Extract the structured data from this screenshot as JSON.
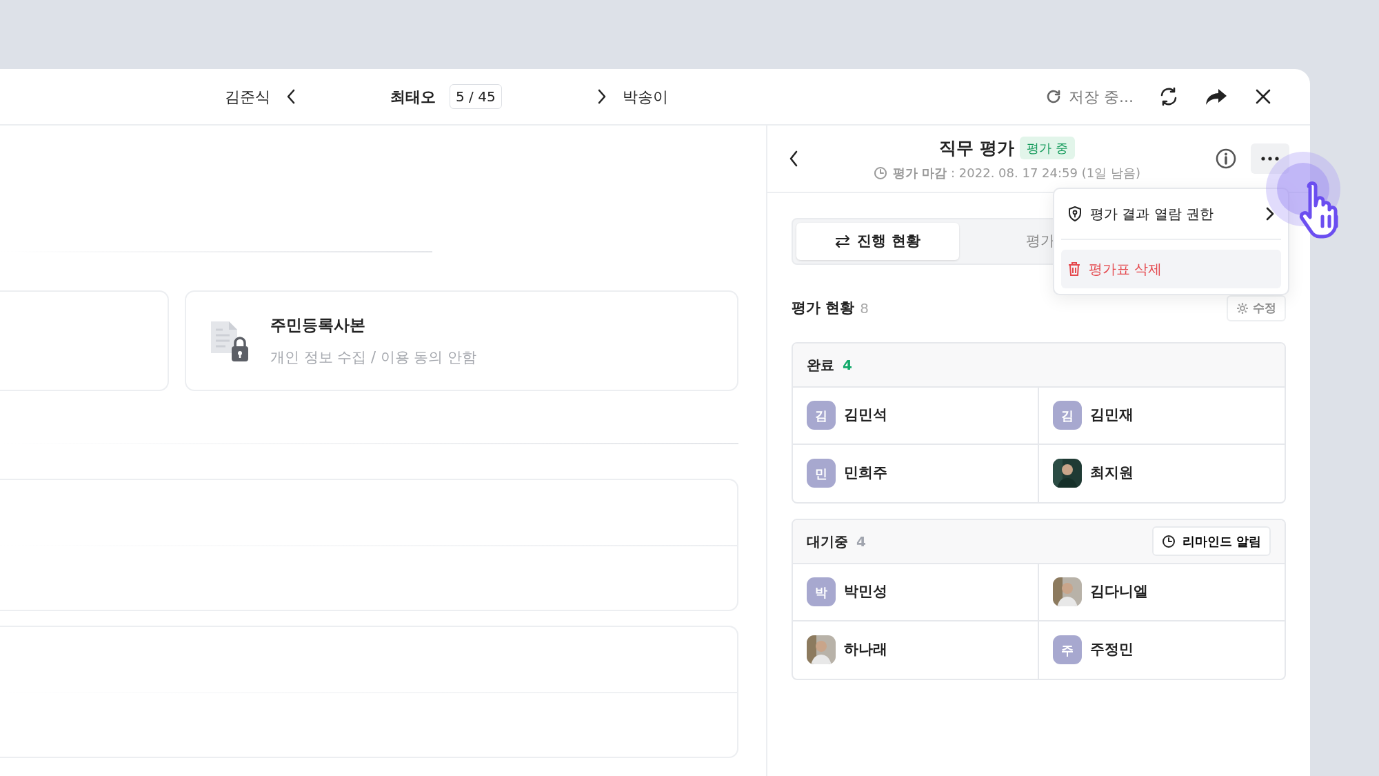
{
  "topbar": {
    "prev_name": "김준식",
    "current_name": "최태오",
    "position": "5 / 45",
    "next_name": "박송이",
    "save_status": "저장 중..."
  },
  "document_card": {
    "title": "주민등록사본",
    "subtitle": "개인 정보 수집 / 이용 동의 안함"
  },
  "panel": {
    "title": "직무 평가",
    "status_badge": "평가 중",
    "deadline": "**평가 마감** : 2022. 08. 17 24:59 (1일 남음)",
    "more_menu_open": true
  },
  "menu": [
    {
      "label": "평가 결과 열람 권한",
      "kind": "submenu",
      "highlighted": false
    },
    {
      "label": "평가표 삭제",
      "kind": "danger",
      "highlighted": true
    }
  ],
  "tabs": [
    {
      "label": "진행 현황",
      "selected": true
    },
    {
      "label": "평가",
      "selected": false
    }
  ],
  "section": {
    "title": "평가 현황",
    "count": "8",
    "edit_button": {
      "label": "수정",
      "disabled": true
    }
  },
  "groups": [
    {
      "title": "완료",
      "count": "4",
      "color": "#12a96a",
      "members": [
        {
          "name": "김민석",
          "avatar": {
            "kind": "initial",
            "text": "김"
          }
        },
        {
          "name": "김민재",
          "avatar": {
            "kind": "initial",
            "text": "김"
          }
        },
        {
          "name": "민희주",
          "avatar": {
            "kind": "initial",
            "text": "민"
          }
        },
        {
          "name": "최지원"
        }
      ]
    },
    {
      "title": "대기중",
      "count": "4",
      "color": "#a0a4ae",
      "reminder_button": "리마인드 알림",
      "members": [
        {
          "name": "박민성",
          "avatar": {
            "kind": "initial",
            "text": "박"
          }
        },
        {
          "name": "김다니엘"
        },
        {
          "name": "하나래"
        },
        {
          "name": "주정민",
          "avatar": {
            "kind": "initial",
            "text": "주"
          }
        }
      ]
    }
  ]
}
